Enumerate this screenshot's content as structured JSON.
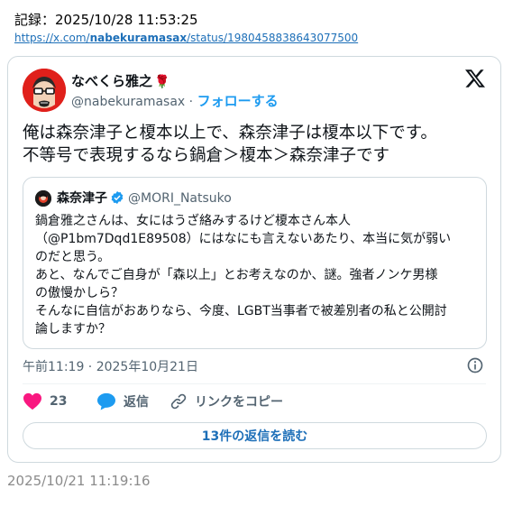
{
  "record": {
    "label": "記録：2025/10/28 11:53:25",
    "url_prefix": "https://x.com/",
    "url_user": "nabekuramasax",
    "url_suffix": "/status/1980458838643077500"
  },
  "tweet": {
    "author_name": "なべくら雅之",
    "author_handle": "@nabekuramasax",
    "separator": "·",
    "follow_label": "フォローする",
    "text_line1": "俺は森奈津子と榎本以上で、森奈津子は榎本以下です。",
    "text_line2": "不等号で表現するなら鍋倉＞榎本＞森奈津子です",
    "timestamp": "午前11:19 · 2025年10月21日",
    "likes": "23",
    "reply_label": "返信",
    "copy_link_label": "リンクをコピー",
    "read_replies_label": "13件の返信を読む"
  },
  "quote": {
    "author_name": "森奈津子",
    "author_handle": "@MORI_Natsuko",
    "text": "鍋倉雅之さんは、女にはうざ絡みするけど榎本さん本人\n（@P1bm7Dqd1E89508）にはなにも言えないあたり、本当に気が弱い\nのだと思う。\nあと、なんでご自身が「森以上」とお考えなのか、謎。強者ノンケ男様\nの傲慢かしら？\nそんなに自信がおありなら、今度、LGBT当事者で被差別者の私と公開討\n論しますか？"
  },
  "footer": {
    "capture_time": "2025/10/21 11:19:16"
  },
  "colors": {
    "accent": "#1d9bf0",
    "like": "#f91880",
    "link": "#1d6fb8"
  }
}
